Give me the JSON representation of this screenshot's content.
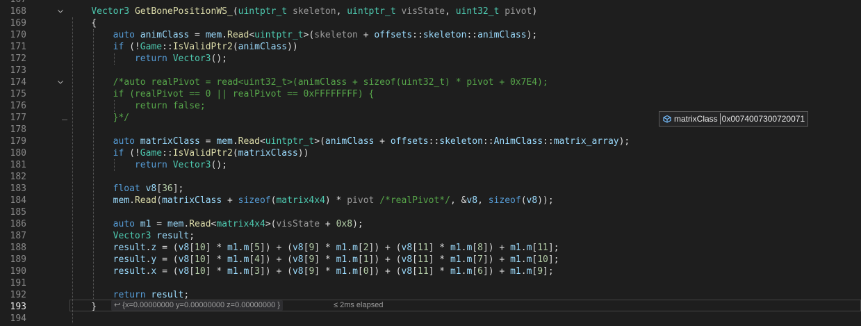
{
  "editor": {
    "lines": [
      {
        "n": "167",
        "fold": "",
        "code": []
      },
      {
        "n": "168",
        "fold": "v",
        "code": [
          [
            "",
            "    "
          ],
          [
            "ty",
            "Vector3"
          ],
          [
            "pl",
            " "
          ],
          [
            "fn",
            "GetBonePositionWS_"
          ],
          [
            "pl",
            "("
          ],
          [
            "ty",
            "uintptr_t"
          ],
          [
            "pl",
            " "
          ],
          [
            "pa",
            "skeleton"
          ],
          [
            "pl",
            ", "
          ],
          [
            "ty",
            "uintptr_t"
          ],
          [
            "pl",
            " "
          ],
          [
            "pa",
            "visState"
          ],
          [
            "pl",
            ", "
          ],
          [
            "ty",
            "uint32_t"
          ],
          [
            "pl",
            " "
          ],
          [
            "pa",
            "pivot"
          ],
          [
            "pl",
            ")"
          ]
        ]
      },
      {
        "n": "169",
        "fold": "",
        "code": [
          [
            "pl",
            "    {"
          ]
        ]
      },
      {
        "n": "170",
        "fold": "",
        "code": [
          [
            "",
            "        "
          ],
          [
            "kw",
            "auto"
          ],
          [
            "pl",
            " "
          ],
          [
            "va",
            "animClass"
          ],
          [
            "pl",
            " = "
          ],
          [
            "va",
            "mem"
          ],
          [
            "pl",
            "."
          ],
          [
            "fn",
            "Read"
          ],
          [
            "pl",
            "<"
          ],
          [
            "ty",
            "uintptr_t"
          ],
          [
            "pl",
            ">("
          ],
          [
            "pa",
            "skeleton"
          ],
          [
            "pl",
            " + "
          ],
          [
            "va",
            "offsets"
          ],
          [
            "pl",
            "::"
          ],
          [
            "va",
            "skeleton"
          ],
          [
            "pl",
            "::"
          ],
          [
            "va",
            "animClass"
          ],
          [
            "pl",
            ");"
          ]
        ]
      },
      {
        "n": "171",
        "fold": "",
        "code": [
          [
            "",
            "        "
          ],
          [
            "kw",
            "if"
          ],
          [
            "pl",
            " (!"
          ],
          [
            "ty",
            "Game"
          ],
          [
            "pl",
            "::"
          ],
          [
            "fn",
            "IsValidPtr2"
          ],
          [
            "pl",
            "("
          ],
          [
            "va",
            "animClass"
          ],
          [
            "pl",
            "))"
          ]
        ]
      },
      {
        "n": "172",
        "fold": "",
        "code": [
          [
            "",
            "            "
          ],
          [
            "kw",
            "return"
          ],
          [
            "pl",
            " "
          ],
          [
            "ty",
            "Vector3"
          ],
          [
            "pl",
            "();"
          ]
        ]
      },
      {
        "n": "173",
        "fold": "",
        "code": []
      },
      {
        "n": "174",
        "fold": "v",
        "code": [
          [
            "",
            "        "
          ],
          [
            "cm",
            "/*auto realPivot = read<uint32_t>(animClass + sizeof(uint32_t) * pivot + 0x7E4);"
          ]
        ]
      },
      {
        "n": "175",
        "fold": "",
        "code": [
          [
            "",
            "        "
          ],
          [
            "cm",
            "if (realPivot == 0 || realPivot == 0xFFFFFFFF) {"
          ]
        ]
      },
      {
        "n": "176",
        "fold": "",
        "code": [
          [
            "",
            "            "
          ],
          [
            "cm",
            "return false;"
          ]
        ]
      },
      {
        "n": "177",
        "fold": "",
        "code": [
          [
            "",
            "        "
          ],
          [
            "cm",
            "}*/"
          ]
        ]
      },
      {
        "n": "178",
        "fold": "",
        "code": []
      },
      {
        "n": "179",
        "fold": "",
        "code": [
          [
            "",
            "        "
          ],
          [
            "kw",
            "auto"
          ],
          [
            "pl",
            " "
          ],
          [
            "va",
            "matrixClass"
          ],
          [
            "pl",
            " = "
          ],
          [
            "va",
            "mem"
          ],
          [
            "pl",
            "."
          ],
          [
            "fn",
            "Read"
          ],
          [
            "pl",
            "<"
          ],
          [
            "ty",
            "uintptr_t"
          ],
          [
            "pl",
            ">("
          ],
          [
            "va",
            "animClass"
          ],
          [
            "pl",
            " + "
          ],
          [
            "va",
            "offsets"
          ],
          [
            "pl",
            "::"
          ],
          [
            "va",
            "skeleton"
          ],
          [
            "pl",
            "::"
          ],
          [
            "va",
            "AnimClass"
          ],
          [
            "pl",
            "::"
          ],
          [
            "va",
            "matrix_array"
          ],
          [
            "pl",
            ");"
          ]
        ]
      },
      {
        "n": "180",
        "fold": "",
        "code": [
          [
            "",
            "        "
          ],
          [
            "kw",
            "if"
          ],
          [
            "pl",
            " (!"
          ],
          [
            "ty",
            "Game"
          ],
          [
            "pl",
            "::"
          ],
          [
            "fn",
            "IsValidPtr2"
          ],
          [
            "pl",
            "("
          ],
          [
            "va",
            "matrixClass"
          ],
          [
            "pl",
            "))"
          ]
        ]
      },
      {
        "n": "181",
        "fold": "",
        "code": [
          [
            "",
            "            "
          ],
          [
            "kw",
            "return"
          ],
          [
            "pl",
            " "
          ],
          [
            "ty",
            "Vector3"
          ],
          [
            "pl",
            "();"
          ]
        ]
      },
      {
        "n": "182",
        "fold": "",
        "code": []
      },
      {
        "n": "183",
        "fold": "",
        "code": [
          [
            "",
            "        "
          ],
          [
            "kw",
            "float"
          ],
          [
            "pl",
            " "
          ],
          [
            "va",
            "v8"
          ],
          [
            "pl",
            "["
          ],
          [
            "nu",
            "36"
          ],
          [
            "pl",
            "];"
          ]
        ]
      },
      {
        "n": "184",
        "fold": "",
        "code": [
          [
            "",
            "        "
          ],
          [
            "va",
            "mem"
          ],
          [
            "pl",
            "."
          ],
          [
            "fn",
            "Read"
          ],
          [
            "pl",
            "("
          ],
          [
            "va",
            "matrixClass"
          ],
          [
            "pl",
            " + "
          ],
          [
            "kw",
            "sizeof"
          ],
          [
            "pl",
            "("
          ],
          [
            "ty",
            "matrix4x4"
          ],
          [
            "pl",
            ") * "
          ],
          [
            "pa",
            "pivot"
          ],
          [
            "pl",
            " "
          ],
          [
            "cm",
            "/*realPivot*/"
          ],
          [
            "pl",
            ", &"
          ],
          [
            "va",
            "v8"
          ],
          [
            "pl",
            ", "
          ],
          [
            "kw",
            "sizeof"
          ],
          [
            "pl",
            "("
          ],
          [
            "va",
            "v8"
          ],
          [
            "pl",
            "));"
          ]
        ]
      },
      {
        "n": "185",
        "fold": "",
        "code": []
      },
      {
        "n": "186",
        "fold": "",
        "code": [
          [
            "",
            "        "
          ],
          [
            "kw",
            "auto"
          ],
          [
            "pl",
            " "
          ],
          [
            "va",
            "m1"
          ],
          [
            "pl",
            " = "
          ],
          [
            "va",
            "mem"
          ],
          [
            "pl",
            "."
          ],
          [
            "fn",
            "Read"
          ],
          [
            "pl",
            "<"
          ],
          [
            "ty",
            "matrix4x4"
          ],
          [
            "pl",
            ">("
          ],
          [
            "pa",
            "visState"
          ],
          [
            "pl",
            " + "
          ],
          [
            "nu",
            "0x8"
          ],
          [
            "pl",
            ");"
          ]
        ]
      },
      {
        "n": "187",
        "fold": "",
        "code": [
          [
            "",
            "        "
          ],
          [
            "ty",
            "Vector3"
          ],
          [
            "pl",
            " "
          ],
          [
            "va",
            "result"
          ],
          [
            "pl",
            ";"
          ]
        ]
      },
      {
        "n": "188",
        "fold": "",
        "code": [
          [
            "",
            "        "
          ],
          [
            "va",
            "result"
          ],
          [
            "pl",
            "."
          ],
          [
            "va",
            "z"
          ],
          [
            "pl",
            " = ("
          ],
          [
            "va",
            "v8"
          ],
          [
            "pl",
            "["
          ],
          [
            "nu",
            "10"
          ],
          [
            "pl",
            "] * "
          ],
          [
            "va",
            "m1"
          ],
          [
            "pl",
            "."
          ],
          [
            "va",
            "m"
          ],
          [
            "pl",
            "["
          ],
          [
            "nu",
            "5"
          ],
          [
            "pl",
            "]) + ("
          ],
          [
            "va",
            "v8"
          ],
          [
            "pl",
            "["
          ],
          [
            "nu",
            "9"
          ],
          [
            "pl",
            "] * "
          ],
          [
            "va",
            "m1"
          ],
          [
            "pl",
            "."
          ],
          [
            "va",
            "m"
          ],
          [
            "pl",
            "["
          ],
          [
            "nu",
            "2"
          ],
          [
            "pl",
            "]) + ("
          ],
          [
            "va",
            "v8"
          ],
          [
            "pl",
            "["
          ],
          [
            "nu",
            "11"
          ],
          [
            "pl",
            "] * "
          ],
          [
            "va",
            "m1"
          ],
          [
            "pl",
            "."
          ],
          [
            "va",
            "m"
          ],
          [
            "pl",
            "["
          ],
          [
            "nu",
            "8"
          ],
          [
            "pl",
            "]) + "
          ],
          [
            "va",
            "m1"
          ],
          [
            "pl",
            "."
          ],
          [
            "va",
            "m"
          ],
          [
            "pl",
            "["
          ],
          [
            "nu",
            "11"
          ],
          [
            "pl",
            "];"
          ]
        ]
      },
      {
        "n": "189",
        "fold": "",
        "code": [
          [
            "",
            "        "
          ],
          [
            "va",
            "result"
          ],
          [
            "pl",
            "."
          ],
          [
            "va",
            "y"
          ],
          [
            "pl",
            " = ("
          ],
          [
            "va",
            "v8"
          ],
          [
            "pl",
            "["
          ],
          [
            "nu",
            "10"
          ],
          [
            "pl",
            "] * "
          ],
          [
            "va",
            "m1"
          ],
          [
            "pl",
            "."
          ],
          [
            "va",
            "m"
          ],
          [
            "pl",
            "["
          ],
          [
            "nu",
            "4"
          ],
          [
            "pl",
            "]) + ("
          ],
          [
            "va",
            "v8"
          ],
          [
            "pl",
            "["
          ],
          [
            "nu",
            "9"
          ],
          [
            "pl",
            "] * "
          ],
          [
            "va",
            "m1"
          ],
          [
            "pl",
            "."
          ],
          [
            "va",
            "m"
          ],
          [
            "pl",
            "["
          ],
          [
            "nu",
            "1"
          ],
          [
            "pl",
            "]) + ("
          ],
          [
            "va",
            "v8"
          ],
          [
            "pl",
            "["
          ],
          [
            "nu",
            "11"
          ],
          [
            "pl",
            "] * "
          ],
          [
            "va",
            "m1"
          ],
          [
            "pl",
            "."
          ],
          [
            "va",
            "m"
          ],
          [
            "pl",
            "["
          ],
          [
            "nu",
            "7"
          ],
          [
            "pl",
            "]) + "
          ],
          [
            "va",
            "m1"
          ],
          [
            "pl",
            "."
          ],
          [
            "va",
            "m"
          ],
          [
            "pl",
            "["
          ],
          [
            "nu",
            "10"
          ],
          [
            "pl",
            "];"
          ]
        ]
      },
      {
        "n": "190",
        "fold": "",
        "code": [
          [
            "",
            "        "
          ],
          [
            "va",
            "result"
          ],
          [
            "pl",
            "."
          ],
          [
            "va",
            "x"
          ],
          [
            "pl",
            " = ("
          ],
          [
            "va",
            "v8"
          ],
          [
            "pl",
            "["
          ],
          [
            "nu",
            "10"
          ],
          [
            "pl",
            "] * "
          ],
          [
            "va",
            "m1"
          ],
          [
            "pl",
            "."
          ],
          [
            "va",
            "m"
          ],
          [
            "pl",
            "["
          ],
          [
            "nu",
            "3"
          ],
          [
            "pl",
            "]) + ("
          ],
          [
            "va",
            "v8"
          ],
          [
            "pl",
            "["
          ],
          [
            "nu",
            "9"
          ],
          [
            "pl",
            "] * "
          ],
          [
            "va",
            "m1"
          ],
          [
            "pl",
            "."
          ],
          [
            "va",
            "m"
          ],
          [
            "pl",
            "["
          ],
          [
            "nu",
            "0"
          ],
          [
            "pl",
            "]) + ("
          ],
          [
            "va",
            "v8"
          ],
          [
            "pl",
            "["
          ],
          [
            "nu",
            "11"
          ],
          [
            "pl",
            "] * "
          ],
          [
            "va",
            "m1"
          ],
          [
            "pl",
            "."
          ],
          [
            "va",
            "m"
          ],
          [
            "pl",
            "["
          ],
          [
            "nu",
            "6"
          ],
          [
            "pl",
            "]) + "
          ],
          [
            "va",
            "m1"
          ],
          [
            "pl",
            "."
          ],
          [
            "va",
            "m"
          ],
          [
            "pl",
            "["
          ],
          [
            "nu",
            "9"
          ],
          [
            "pl",
            "];"
          ]
        ]
      },
      {
        "n": "191",
        "fold": "",
        "code": []
      },
      {
        "n": "192",
        "fold": "",
        "code": [
          [
            "",
            "        "
          ],
          [
            "kw",
            "return"
          ],
          [
            "pl",
            " "
          ],
          [
            "va",
            "result"
          ],
          [
            "pl",
            ";"
          ]
        ]
      },
      {
        "n": "193",
        "fold": "",
        "current": true,
        "code": [
          [
            "pl",
            "    }"
          ]
        ]
      },
      {
        "n": "194",
        "fold": "",
        "code": []
      }
    ]
  },
  "tooltip": {
    "icon": "variable-icon",
    "name": "matrixClass",
    "value": "0x0074007300720071"
  },
  "inline_result": {
    "icon": "return-arrow-icon",
    "arrow": "↩",
    "text": "{x=0.00000000 y=0.00000000 z=0.00000000 }"
  },
  "elapsed": "≤ 2ms elapsed",
  "colors": {
    "background": "#1e1e1e",
    "keyword": "#569cd6",
    "type": "#4ec9b0",
    "function": "#dcdcaa",
    "variable": "#9cdcfe",
    "parameter": "#9a9a9a",
    "comment": "#57a64a",
    "number": "#b5cea8"
  }
}
